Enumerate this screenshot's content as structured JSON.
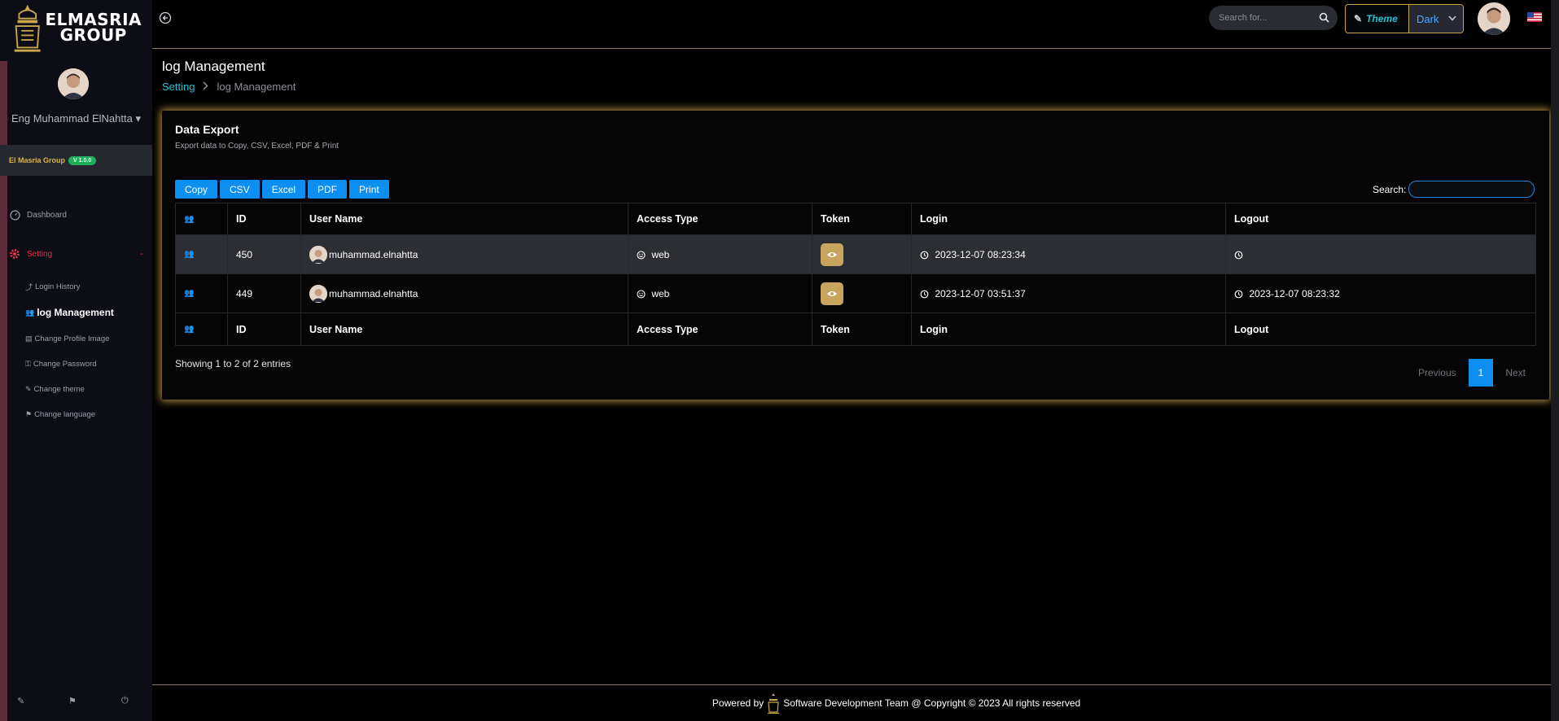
{
  "brand": {
    "line1": "ELMASRIA",
    "line2": "GROUP"
  },
  "sidebar": {
    "user_name": "Eng Muhammad ElNahtta",
    "user_caret": "▾",
    "org": "El Masria Group",
    "version": "V 1.0.0",
    "items": [
      {
        "label": "Dashboard",
        "icon": "dashboard-icon"
      },
      {
        "label": "Setting",
        "icon": "gear-icon",
        "sign": "-"
      }
    ],
    "sub_items": [
      {
        "label": "Login History",
        "icon": "login-icon"
      },
      {
        "label": "log Management",
        "icon": "users-icon"
      },
      {
        "label": "Change Profile Image",
        "icon": "id-card-icon"
      },
      {
        "label": "Change Password",
        "icon": "user-key-icon"
      },
      {
        "label": "Change theme",
        "icon": "palette-icon"
      },
      {
        "label": "Change language",
        "icon": "language-icon"
      }
    ],
    "footer_icons": [
      "palette-icon",
      "language-icon",
      "power-icon"
    ]
  },
  "header": {
    "search_placeholder": "Search for...",
    "theme_label": "Theme",
    "theme_value": "Dark",
    "flag": "us-flag"
  },
  "page": {
    "title": "log Management",
    "breadcrumb": {
      "parent": "Setting",
      "current": "log Management",
      "sep": ">"
    }
  },
  "card": {
    "title": "Data Export",
    "subtitle": "Export data to Copy, CSV, Excel, PDF & Print",
    "buttons": [
      "Copy",
      "CSV",
      "Excel",
      "PDF",
      "Print"
    ],
    "search_label": "Search:",
    "columns": [
      "ID",
      "User Name",
      "Access Type",
      "Token",
      "Login",
      "Logout"
    ],
    "rows": [
      {
        "id": "450",
        "user": "muhammad.elnahtta",
        "access": "web",
        "login": "2023-12-07 08:23:34",
        "logout": ""
      },
      {
        "id": "449",
        "user": "muhammad.elnahtta",
        "access": "web",
        "login": "2023-12-07 03:51:37",
        "logout": "2023-12-07 08:23:32"
      }
    ],
    "info": "Showing 1 to 2 of 2 entries",
    "pager": {
      "prev": "Previous",
      "page": "1",
      "next": "Next"
    }
  },
  "footer": {
    "powered": "Powered by",
    "text": "Software Development Team @ Copyright © 2023 All rights reserved"
  },
  "colors": {
    "accent": "#0d8ff2",
    "gold": "#c9a64a",
    "teal": "#21c4d6",
    "danger": "#e0344b"
  }
}
